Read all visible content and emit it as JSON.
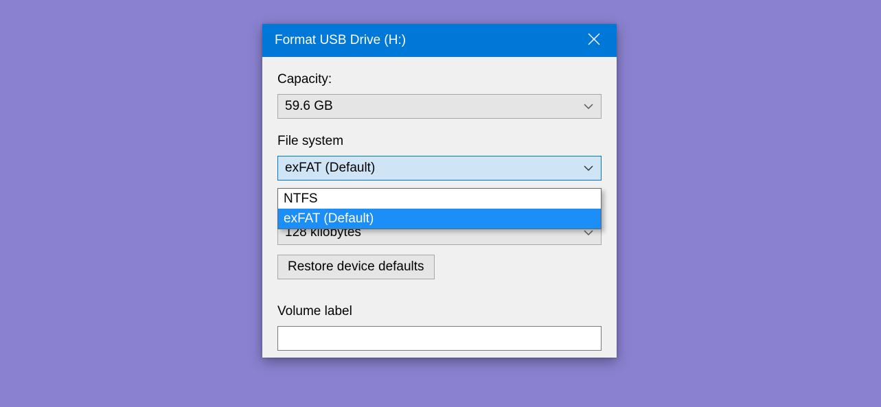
{
  "titlebar": {
    "title": "Format USB Drive (H:)"
  },
  "capacity": {
    "label": "Capacity:",
    "value": "59.6 GB"
  },
  "filesystem": {
    "label": "File system",
    "value": "exFAT (Default)",
    "options": [
      "NTFS",
      "exFAT (Default)"
    ],
    "highlighted_index": 1
  },
  "allocation": {
    "value": "128 kilobytes"
  },
  "restore_button": {
    "label": "Restore device defaults"
  },
  "volume_label": {
    "label": "Volume label",
    "value": ""
  }
}
